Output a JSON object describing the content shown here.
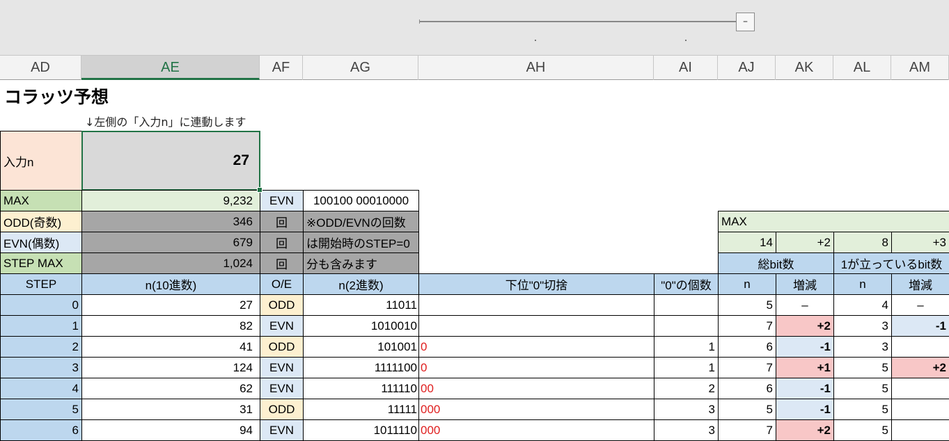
{
  "ribbon": {
    "collapse_label": "–"
  },
  "columns": [
    "AD",
    "AE",
    "AF",
    "AG",
    "AH",
    "AI",
    "AJ",
    "AK",
    "AL",
    "AM"
  ],
  "selected_column": "AE",
  "title": "コラッツ予想",
  "note": "↓左側の「入力n」に連動します",
  "input": {
    "label": "入力n",
    "value": "27"
  },
  "max": {
    "label": "MAX",
    "value": "9,232",
    "evn": "EVN",
    "binary": "100100 00010000"
  },
  "odd": {
    "label": "ODD(奇数)",
    "value": "346",
    "unit": "回",
    "note": "※ODD/EVNの回数"
  },
  "evn": {
    "label": "EVN(偶数)",
    "value": "679",
    "unit": "回",
    "note": "は開始時のSTEP=0"
  },
  "stepmax": {
    "label": "STEP MAX",
    "value": "1,024",
    "unit": "回",
    "note": "分も含みます"
  },
  "bitmax": {
    "label": "MAX",
    "total_n": "14",
    "total_diff": "+2",
    "ones_n": "8",
    "ones_diff": "+3",
    "total_label": "総bit数",
    "ones_label": "1が立っているbit数"
  },
  "headers": [
    "STEP",
    "n(10進数)",
    "O/E",
    "n(2進数)",
    "下位\"0\"切捨",
    "\"0\"の個数",
    "n",
    "増減",
    "n",
    "増減"
  ],
  "rows": [
    {
      "step": "0",
      "n": "27",
      "oe": "ODD",
      "bin": "11011",
      "trail": "",
      "zeros": "",
      "bits": "5",
      "bdiff": "–",
      "ones": "4",
      "odiff": "–"
    },
    {
      "step": "1",
      "n": "82",
      "oe": "EVN",
      "bin": "1010010",
      "trail": "",
      "zeros": "",
      "bits": "7",
      "bdiff": "+2",
      "ones": "3",
      "odiff": "-1"
    },
    {
      "step": "2",
      "n": "41",
      "oe": "ODD",
      "bin": "101001",
      "trail": "0",
      "zeros": "1",
      "bits": "6",
      "bdiff": "-1",
      "ones": "3",
      "odiff": ""
    },
    {
      "step": "3",
      "n": "124",
      "oe": "EVN",
      "bin": "1111100",
      "trail": "0",
      "zeros": "1",
      "bits": "7",
      "bdiff": "+1",
      "ones": "5",
      "odiff": "+2"
    },
    {
      "step": "4",
      "n": "62",
      "oe": "EVN",
      "bin": "111110",
      "trail": "00",
      "zeros": "2",
      "bits": "6",
      "bdiff": "-1",
      "ones": "5",
      "odiff": ""
    },
    {
      "step": "5",
      "n": "31",
      "oe": "ODD",
      "bin": "11111",
      "trail": "000",
      "zeros": "3",
      "bits": "5",
      "bdiff": "-1",
      "ones": "5",
      "odiff": ""
    },
    {
      "step": "6",
      "n": "94",
      "oe": "EVN",
      "bin": "1011110",
      "trail": "000",
      "zeros": "3",
      "bits": "7",
      "bdiff": "+2",
      "ones": "5",
      "odiff": ""
    }
  ],
  "colors": {
    "pos": "#f8c7c7",
    "neg": "#dce8f5",
    "odd": "#fdf0d0",
    "evn": "#dce8f5",
    "header": "#bdd7ee",
    "green": "#c6e0b4",
    "lightgreen": "#e2efda",
    "salmon": "#fce4d6",
    "gray": "#a6a6a6",
    "input_bg": "#d9d9d9"
  }
}
